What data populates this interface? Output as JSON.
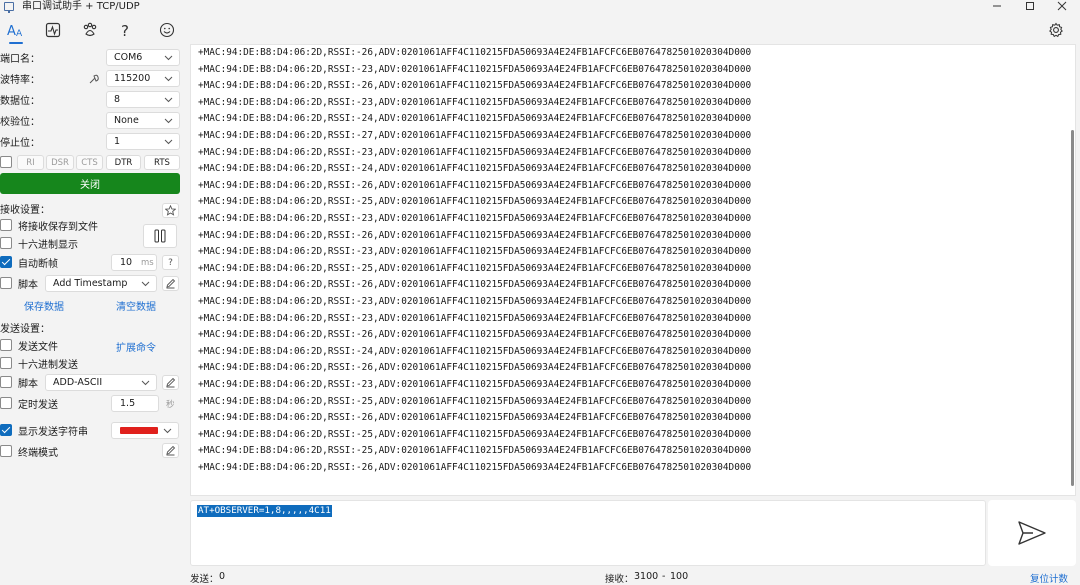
{
  "window": {
    "title": "串口调试助手 + TCP/UDP"
  },
  "toolbar": {
    "icons": [
      "text-format-icon",
      "pulse-chart-icon",
      "paw-icon",
      "help-icon",
      "smiley-icon"
    ],
    "settings_icon": "gear-icon"
  },
  "serial": {
    "port_label": "端口名：",
    "port_value": "COM6",
    "baud_label": "波特率：",
    "baud_value": "115200",
    "databits_label": "数据位：",
    "databits_value": "8",
    "parity_label": "校验位：",
    "parity_value": "None",
    "stopbits_label": "停止位：",
    "stopbits_value": "1",
    "pins": [
      "RI",
      "DSR",
      "CTS",
      "DTR",
      "RTS"
    ],
    "close_label": "关闭"
  },
  "receive": {
    "header": "接收设置：",
    "save_to_file": "将接收保存到文件",
    "hex_display": "十六进制显示",
    "auto_frame": "自动断帧",
    "auto_frame_value": "10",
    "auto_frame_unit": "ms",
    "help": "?",
    "script_label": "脚本",
    "script_value": "Add Timestamp",
    "save_data": "保存数据",
    "clear_data": "清空数据"
  },
  "send": {
    "header": "发送设置：",
    "send_file": "发送文件",
    "extend_cmd": "扩展命令",
    "hex_send": "十六进制发送",
    "script_label": "脚本",
    "script_value": "ADD-ASCII",
    "timed_send": "定时发送",
    "timed_value": "1.5",
    "timed_unit": "秒",
    "show_send_string": "显示发送字符串",
    "show_send_color": "#e0201c",
    "terminal_mode": "终端模式"
  },
  "log": {
    "lines": [
      "+MAC:94:DE:B8:D4:06:2D,RSSI:-26,ADV:0201061AFF4C110215FDA50693A4E24FB1AFCFC6EB0764782501020304D000",
      "+MAC:94:DE:B8:D4:06:2D,RSSI:-23,ADV:0201061AFF4C110215FDA50693A4E24FB1AFCFC6EB0764782501020304D000",
      "+MAC:94:DE:B8:D4:06:2D,RSSI:-26,ADV:0201061AFF4C110215FDA50693A4E24FB1AFCFC6EB0764782501020304D000",
      "+MAC:94:DE:B8:D4:06:2D,RSSI:-23,ADV:0201061AFF4C110215FDA50693A4E24FB1AFCFC6EB0764782501020304D000",
      "+MAC:94:DE:B8:D4:06:2D,RSSI:-24,ADV:0201061AFF4C110215FDA50693A4E24FB1AFCFC6EB0764782501020304D000",
      "+MAC:94:DE:B8:D4:06:2D,RSSI:-27,ADV:0201061AFF4C110215FDA50693A4E24FB1AFCFC6EB0764782501020304D000",
      "+MAC:94:DE:B8:D4:06:2D,RSSI:-23,ADV:0201061AFF4C110215FDA50693A4E24FB1AFCFC6EB0764782501020304D000",
      "+MAC:94:DE:B8:D4:06:2D,RSSI:-24,ADV:0201061AFF4C110215FDA50693A4E24FB1AFCFC6EB0764782501020304D000",
      "+MAC:94:DE:B8:D4:06:2D,RSSI:-26,ADV:0201061AFF4C110215FDA50693A4E24FB1AFCFC6EB0764782501020304D000",
      "+MAC:94:DE:B8:D4:06:2D,RSSI:-25,ADV:0201061AFF4C110215FDA50693A4E24FB1AFCFC6EB0764782501020304D000",
      "+MAC:94:DE:B8:D4:06:2D,RSSI:-23,ADV:0201061AFF4C110215FDA50693A4E24FB1AFCFC6EB0764782501020304D000",
      "+MAC:94:DE:B8:D4:06:2D,RSSI:-26,ADV:0201061AFF4C110215FDA50693A4E24FB1AFCFC6EB0764782501020304D000",
      "+MAC:94:DE:B8:D4:06:2D,RSSI:-23,ADV:0201061AFF4C110215FDA50693A4E24FB1AFCFC6EB0764782501020304D000",
      "+MAC:94:DE:B8:D4:06:2D,RSSI:-25,ADV:0201061AFF4C110215FDA50693A4E24FB1AFCFC6EB0764782501020304D000",
      "+MAC:94:DE:B8:D4:06:2D,RSSI:-26,ADV:0201061AFF4C110215FDA50693A4E24FB1AFCFC6EB0764782501020304D000",
      "+MAC:94:DE:B8:D4:06:2D,RSSI:-23,ADV:0201061AFF4C110215FDA50693A4E24FB1AFCFC6EB0764782501020304D000",
      "+MAC:94:DE:B8:D4:06:2D,RSSI:-23,ADV:0201061AFF4C110215FDA50693A4E24FB1AFCFC6EB0764782501020304D000",
      "+MAC:94:DE:B8:D4:06:2D,RSSI:-26,ADV:0201061AFF4C110215FDA50693A4E24FB1AFCFC6EB0764782501020304D000",
      "+MAC:94:DE:B8:D4:06:2D,RSSI:-24,ADV:0201061AFF4C110215FDA50693A4E24FB1AFCFC6EB0764782501020304D000",
      "+MAC:94:DE:B8:D4:06:2D,RSSI:-26,ADV:0201061AFF4C110215FDA50693A4E24FB1AFCFC6EB0764782501020304D000",
      "+MAC:94:DE:B8:D4:06:2D,RSSI:-23,ADV:0201061AFF4C110215FDA50693A4E24FB1AFCFC6EB0764782501020304D000",
      "+MAC:94:DE:B8:D4:06:2D,RSSI:-25,ADV:0201061AFF4C110215FDA50693A4E24FB1AFCFC6EB0764782501020304D000",
      "+MAC:94:DE:B8:D4:06:2D,RSSI:-26,ADV:0201061AFF4C110215FDA50693A4E24FB1AFCFC6EB0764782501020304D000",
      "+MAC:94:DE:B8:D4:06:2D,RSSI:-25,ADV:0201061AFF4C110215FDA50693A4E24FB1AFCFC6EB0764782501020304D000",
      "+MAC:94:DE:B8:D4:06:2D,RSSI:-25,ADV:0201061AFF4C110215FDA50693A4E24FB1AFCFC6EB0764782501020304D000",
      "+MAC:94:DE:B8:D4:06:2D,RSSI:-26,ADV:0201061AFF4C110215FDA50693A4E24FB1AFCFC6EB0764782501020304D000"
    ]
  },
  "input": {
    "value": "AT+OBSERVER=1,8,,,,,4C11"
  },
  "status": {
    "sent_label": "发送：",
    "sent_value": "0",
    "recv_label": "接收：",
    "recv_value": "3100",
    "recv_sep": "-",
    "recv_extra": "100",
    "reset_count": "复位计数"
  }
}
